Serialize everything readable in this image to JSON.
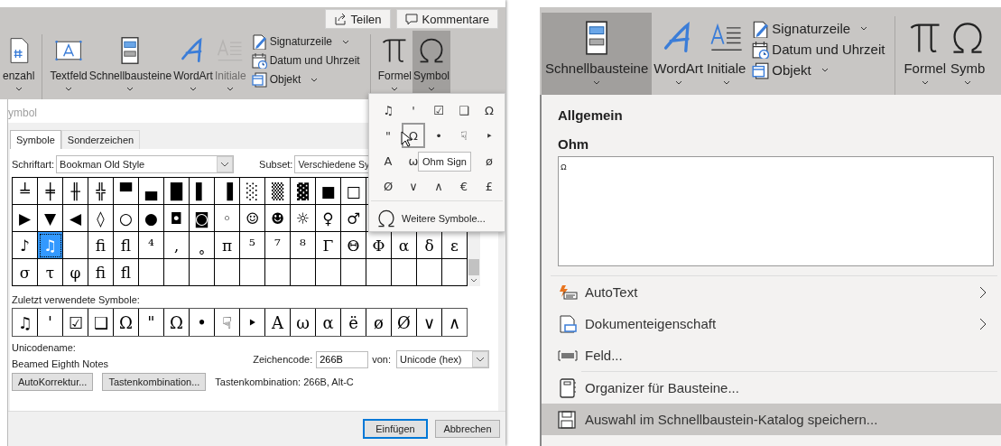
{
  "left": {
    "header_buttons": [
      {
        "label": "Teilen"
      },
      {
        "label": "Kommentare"
      }
    ],
    "ribbon_groups": [
      [
        {
          "kind": "large",
          "label": "enzahl",
          "selected": false,
          "disabled": false
        }
      ],
      [
        {
          "kind": "large",
          "label": "Textfeld",
          "selected": false,
          "disabled": false
        },
        {
          "kind": "large",
          "label": "Schnellbausteine",
          "selected": false,
          "disabled": false
        },
        {
          "kind": "large",
          "label": "WordArt",
          "selected": false,
          "disabled": false
        },
        {
          "kind": "large",
          "label": "Initiale",
          "selected": false,
          "disabled": true
        },
        {
          "kind": "stack",
          "items": [
            {
              "label": "Signaturzeile",
              "dropdown": true
            },
            {
              "label": "Datum und Uhrzeit",
              "dropdown": false
            },
            {
              "label": "Objekt",
              "dropdown": true
            }
          ]
        }
      ],
      [
        {
          "kind": "large",
          "label": "Formel",
          "selected": false,
          "disabled": false
        },
        {
          "kind": "large",
          "label": "Symbol",
          "selected": true,
          "disabled": false
        }
      ]
    ],
    "dialog": {
      "title": "ymbol",
      "tabs": [
        {
          "label": "Symbole",
          "selected": true
        },
        {
          "label": "Sonderzeichen",
          "selected": false
        }
      ],
      "font_label": "Schriftart:",
      "font_value": "Bookman Old Style",
      "subset_label": "Subset:",
      "subset_value": "Verschiedene Sy",
      "grid": [
        [
          {
            "char": "╧",
            "selected": false
          },
          {
            "char": "╪",
            "selected": false
          },
          {
            "char": "╫",
            "selected": false
          },
          {
            "char": "╬",
            "selected": false
          },
          {
            "char": "▀",
            "selected": false
          },
          {
            "char": "▄",
            "selected": false
          },
          {
            "char": "█",
            "selected": false
          },
          {
            "char": "▌",
            "selected": false
          },
          {
            "char": "▐",
            "selected": false
          },
          {
            "char": "░",
            "selected": false
          },
          {
            "char": "▒",
            "selected": false
          },
          {
            "char": "▓",
            "selected": false
          },
          {
            "char": "■",
            "selected": false
          },
          {
            "char": "□",
            "selected": false
          }
        ],
        [
          {
            "char": "▶",
            "selected": false
          },
          {
            "char": "▼",
            "selected": false
          },
          {
            "char": "◀",
            "selected": false
          },
          {
            "char": "◊",
            "selected": false
          },
          {
            "char": "○",
            "selected": false
          },
          {
            "char": "●",
            "selected": false
          },
          {
            "char": "◘",
            "selected": false
          },
          {
            "char": "◙",
            "selected": false
          },
          {
            "char": "◦",
            "selected": false
          },
          {
            "char": "☺",
            "selected": false
          },
          {
            "char": "☻",
            "selected": false
          },
          {
            "char": "☼",
            "selected": false
          },
          {
            "char": "♀",
            "selected": false
          },
          {
            "char": "♂",
            "selected": false
          }
        ],
        [
          {
            "char": "♪",
            "selected": false
          },
          {
            "char": "♫",
            "selected": true
          },
          {
            "selected": false
          },
          {
            "char": "ﬁ",
            "selected": false
          },
          {
            "char": "ﬂ",
            "selected": false
          },
          {
            "char": "⁴",
            "selected": false
          },
          {
            "char": "‚",
            "selected": false
          },
          {
            "char": "˳",
            "selected": false
          },
          {
            "char": "π",
            "selected": false
          },
          {
            "char": "⁵",
            "selected": false
          },
          {
            "char": "⁷",
            "selected": false
          },
          {
            "char": "⁸",
            "selected": false
          },
          {
            "char": "Γ",
            "selected": false
          },
          {
            "char": "Θ",
            "selected": false
          },
          {
            "char": "Φ",
            "selected": false
          },
          {
            "char": "α",
            "selected": false
          },
          {
            "char": "δ",
            "selected": false
          },
          {
            "char": "ε",
            "selected": false
          }
        ],
        [
          {
            "char": "σ",
            "selected": false
          },
          {
            "char": "τ",
            "selected": false
          },
          {
            "char": "φ",
            "selected": false
          },
          {
            "char": "ﬁ",
            "selected": false
          },
          {
            "char": "ﬂ",
            "selected": false
          }
        ]
      ],
      "recent_label": "Zuletzt verwendete Symbole:",
      "recent": [
        "♫",
        "'",
        "☑",
        "❑",
        "Ω",
        "\"",
        "Ω",
        "•",
        "☟",
        "‣",
        "A",
        "ω",
        "α",
        "ë",
        "ø",
        "Ø",
        "∨",
        "∧"
      ],
      "unicode_name_label": "Unicodename:",
      "unicode_name": "Beamed Eighth Notes",
      "code_label": "Zeichencode:",
      "code_value": "266B",
      "from_label": "von:",
      "from_value": "Unicode (hex)",
      "buttons": [
        {
          "label": "AutoKorrektur..."
        },
        {
          "label": "Tastenkombination..."
        }
      ],
      "shortcut_text": "Tastenkombination: 266B, Alt-C",
      "footer_buttons": [
        {
          "label": "Einfügen",
          "default": true
        },
        {
          "label": "Abbrechen",
          "default": false
        }
      ]
    },
    "symbol_menu": {
      "rows": [
        [
          {
            "char": "♫",
            "hovered": false
          },
          {
            "char": "'",
            "hovered": false
          },
          {
            "char": "☑",
            "hovered": false
          },
          {
            "char": "❑",
            "hovered": false
          },
          {
            "char": "Ω",
            "hovered": false
          }
        ],
        [
          {
            "char": "\"",
            "hovered": false
          },
          {
            "char": "Ω",
            "hovered": true
          },
          {
            "char": "•",
            "hovered": false
          },
          {
            "char": "☟",
            "hovered": false
          },
          {
            "char": "‣",
            "hovered": false
          }
        ],
        [
          {
            "char": "A",
            "hovered": false
          },
          {
            "char": "ω",
            "hovered": false
          },
          {
            "hovered": false
          },
          {
            "hovered": false
          },
          {
            "char": "ø",
            "hovered": false
          }
        ],
        [
          {
            "char": "Ø",
            "hovered": false
          },
          {
            "char": "∨",
            "hovered": false
          },
          {
            "char": "∧",
            "hovered": false
          },
          {
            "char": "€",
            "hovered": false
          },
          {
            "char": "£",
            "hovered": false
          }
        ]
      ],
      "more": "Weitere Symbole...",
      "tooltip": "Ohm Sign"
    }
  },
  "right": {
    "ribbon_groups": [
      [
        {
          "kind": "large",
          "label": "Schnellbausteine",
          "selected": true,
          "disabled": false
        },
        {
          "kind": "large",
          "label": "WordArt",
          "selected": false,
          "disabled": false
        },
        {
          "kind": "large",
          "label": "Initiale",
          "selected": false,
          "disabled": false
        },
        {
          "kind": "stack",
          "items": [
            {
              "label": "Signaturzeile",
              "dropdown": true
            },
            {
              "label": "Datum und Uhrzeit",
              "dropdown": false
            },
            {
              "label": "Objekt",
              "dropdown": true
            }
          ]
        }
      ],
      [
        {
          "kind": "large",
          "label": "Formel",
          "selected": false,
          "disabled": false
        },
        {
          "kind": "large",
          "label": "Symb",
          "selected": false,
          "disabled": false
        }
      ]
    ],
    "menu": {
      "heading": "Allgemein",
      "entry_title": "Ohm",
      "preview": "Ω",
      "item_groups": [
        [
          {
            "label": "AutoText",
            "submenu": true,
            "hovered": false
          },
          {
            "label": "Dokumenteigenschaft",
            "submenu": true,
            "hovered": false
          },
          {
            "label": "Feld...",
            "submenu": false,
            "hovered": false
          }
        ],
        [
          {
            "label": "Organizer für Bausteine...",
            "submenu": false,
            "hovered": false
          },
          {
            "label": "Auswahl im Schnellbaustein-Katalog speichern...",
            "submenu": false,
            "hovered": true
          }
        ]
      ]
    }
  }
}
